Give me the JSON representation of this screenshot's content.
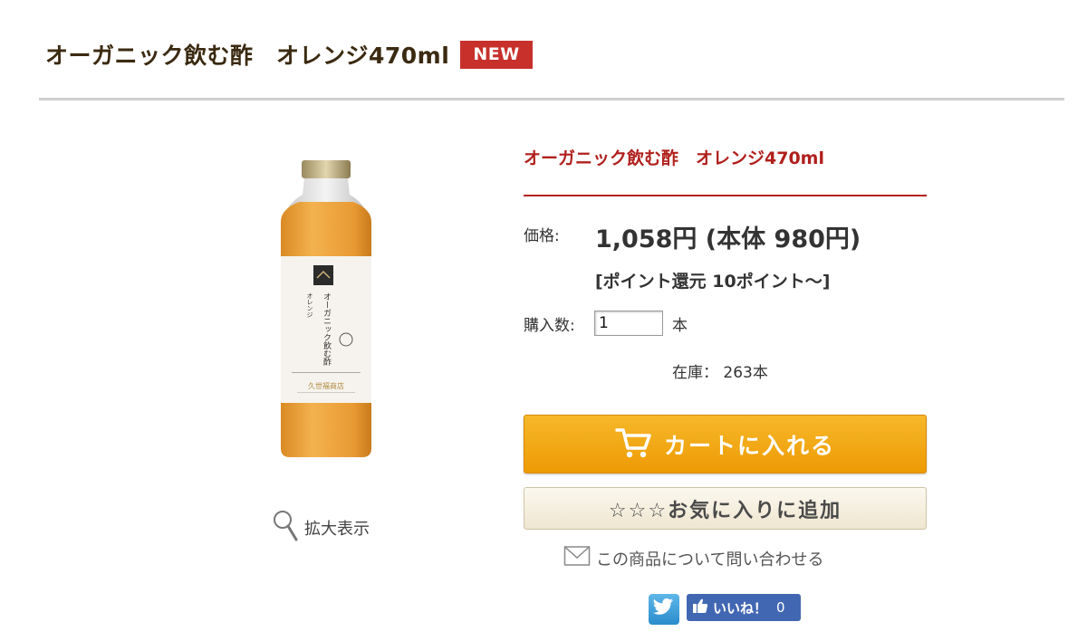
{
  "header": {
    "title": "オーガニック飲む酢　オレンジ470ml",
    "badge": "NEW"
  },
  "product": {
    "name": "オーガニック飲む酢　オレンジ470ml",
    "price_label": "価格:",
    "price": "1,058円 (本体 980円)",
    "points": "[ポイント還元 10ポイント～]",
    "quantity_label": "購入数:",
    "quantity_value": "1",
    "quantity_unit": "本",
    "stock_label": "在庫：",
    "stock_value": "263本",
    "bottle_label": {
      "vertical_1": "オーガニック飲む酢",
      "vertical_2": "オレンジ",
      "brand": "久世福商店"
    }
  },
  "actions": {
    "zoom": "拡大表示",
    "add_to_cart": "カートに入れる",
    "add_to_favorites": "☆☆☆お気に入りに追加",
    "inquiry": "この商品について問い合わせる",
    "facebook_like": "いいね！",
    "facebook_count": "0"
  },
  "icons": {
    "zoom": "magnifier-icon",
    "cart": "cart-icon",
    "mail": "mail-icon",
    "twitter": "twitter-icon",
    "facebook": "thumbs-up-icon"
  },
  "colors": {
    "title": "#3b2a12",
    "accent_red": "#b0201d",
    "badge": "#c7302b",
    "cart_button": "#f0a30a",
    "facebook": "#4267b2",
    "bottle_juice": "#eaa13c"
  }
}
